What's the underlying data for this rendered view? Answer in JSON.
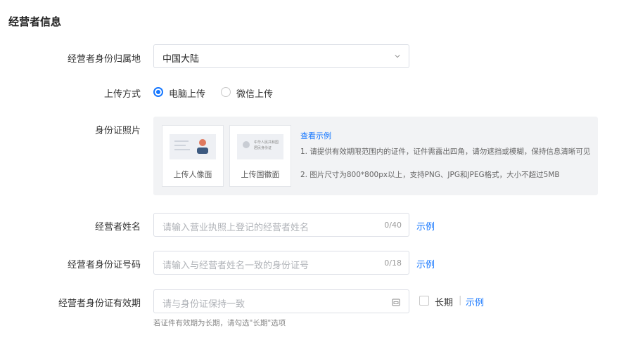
{
  "section_title": "经营者信息",
  "region": {
    "label": "经营者身份归属地",
    "value": "中国大陆"
  },
  "upload_method": {
    "label": "上传方式",
    "options": [
      "电脑上传",
      "微信上传"
    ],
    "selected": "电脑上传"
  },
  "id_photo": {
    "label": "身份证照片",
    "front_label": "上传人像面",
    "back_label": "上传国徽面",
    "back_card_lines": [
      "中华人民共和国",
      "居民身份证"
    ],
    "example_link": "查看示例",
    "tips": [
      "1. 请提供有效期限范围内的证件，证件需露出四角，请勿遮挡或模糊，保持信息清晰可见",
      "2. 图片尺寸为800*800px以上，支持PNG、JPG和JPEG格式，大小不超过5MB"
    ]
  },
  "operator_name": {
    "label": "经营者姓名",
    "placeholder": "请输入营业执照上登记的经营者姓名",
    "counter": "0/40",
    "example": "示例"
  },
  "id_number": {
    "label": "经营者身份证号码",
    "placeholder": "请输入与经营者姓名一致的身份证号",
    "counter": "0/18",
    "example": "示例"
  },
  "id_validity": {
    "label": "经营者身份证有效期",
    "placeholder": "请与身份证保持一致",
    "long_term": "长期",
    "separator": "|",
    "example": "示例",
    "hint": "若证件有效期为长期，请勾选\"长期\"选项"
  },
  "colors": {
    "accent": "#1677ff",
    "border": "#dcdfe6",
    "panel": "#f2f3f5"
  }
}
